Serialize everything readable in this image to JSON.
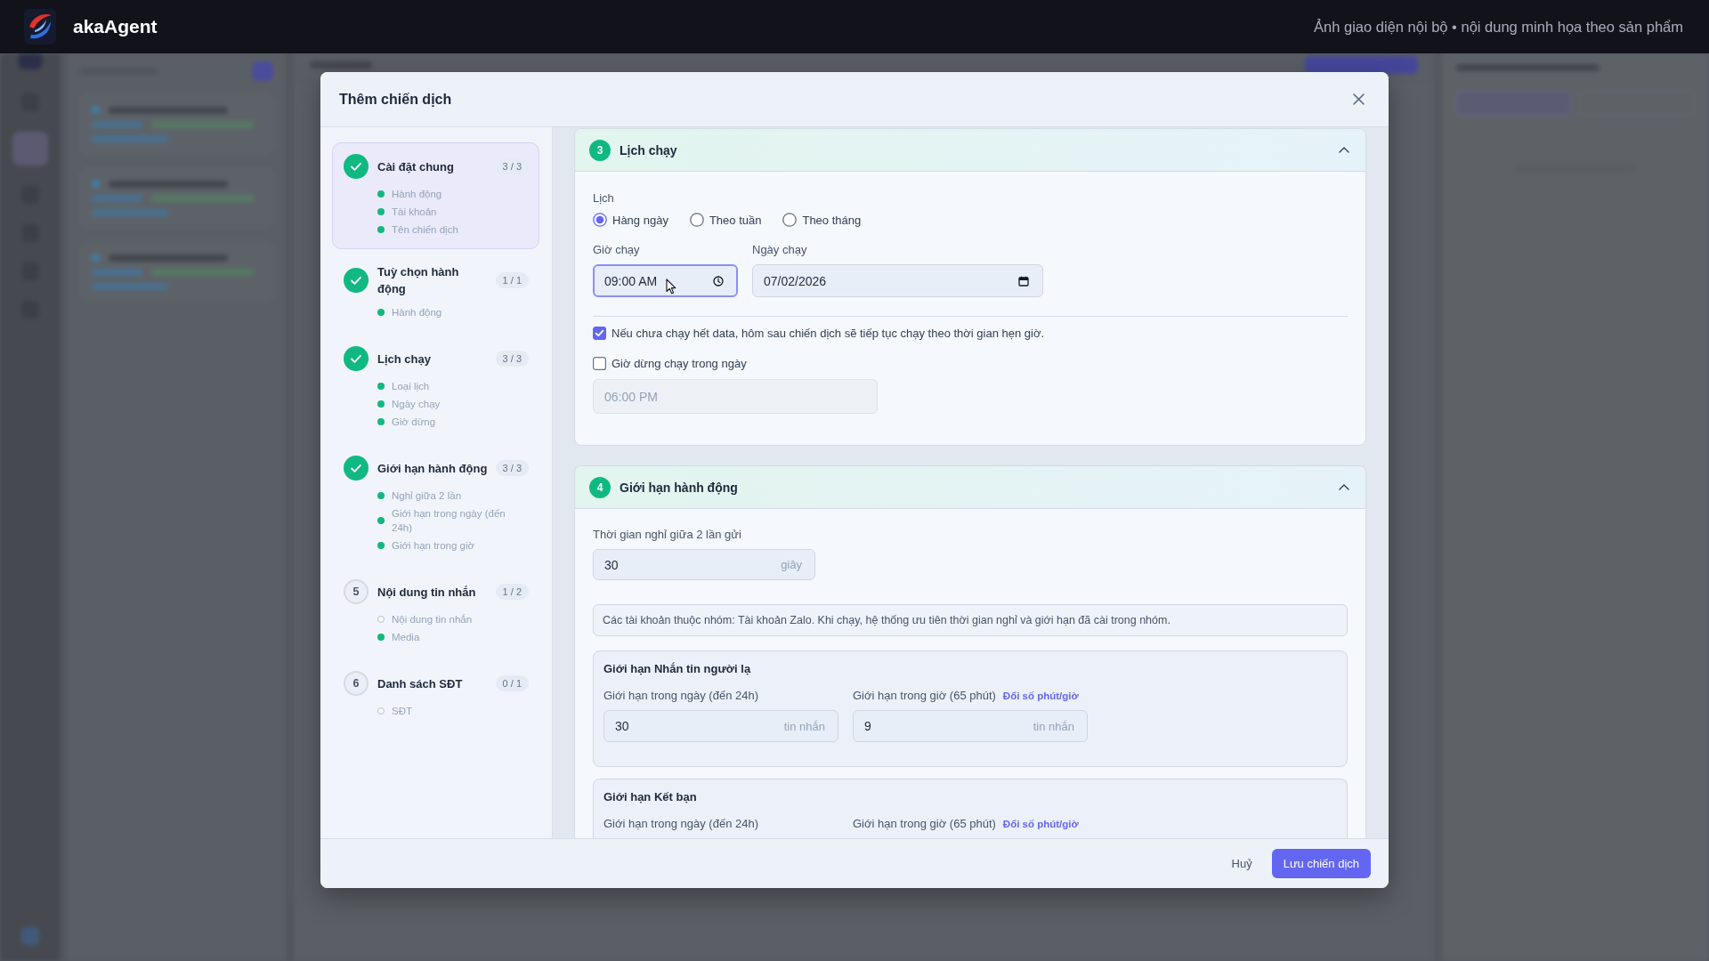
{
  "app_bar": {
    "brand": "akaAgent",
    "notice": "Ảnh giao diện nội bộ • nội dung minh họa theo sản phẩm"
  },
  "dialog": {
    "title": "Thêm chiến dịch",
    "steps": [
      {
        "title": "Cài đặt chung",
        "progress": "3 / 3",
        "done": true,
        "selected": true,
        "items": [
          {
            "label": "Hành động",
            "done": true
          },
          {
            "label": "Tài khoản",
            "done": true
          },
          {
            "label": "Tên chiến dịch",
            "done": true
          }
        ]
      },
      {
        "title": "Tuỳ chọn hành động",
        "progress": "1 / 1",
        "done": true,
        "selected": false,
        "items": [
          {
            "label": "Hành động",
            "done": true
          }
        ]
      },
      {
        "title": "Lịch chạy",
        "progress": "3 / 3",
        "done": true,
        "selected": false,
        "items": [
          {
            "label": "Loại lịch",
            "done": true
          },
          {
            "label": "Ngày chạy",
            "done": true
          },
          {
            "label": "Giờ dừng",
            "done": true
          }
        ]
      },
      {
        "title": "Giới hạn hành động",
        "progress": "3 / 3",
        "done": true,
        "selected": false,
        "items": [
          {
            "label": "Nghỉ giữa 2 lần",
            "done": true
          },
          {
            "label": "Giới hạn trong ngày (đến 24h)",
            "done": true
          },
          {
            "label": "Giới hạn trong giờ",
            "done": true
          }
        ]
      },
      {
        "number": "5",
        "title": "Nội dung tin nhắn",
        "progress": "1 / 2",
        "done": false,
        "selected": false,
        "items": [
          {
            "label": "Nội dung tin nhắn",
            "done": false
          },
          {
            "label": "Media",
            "done": true
          }
        ]
      },
      {
        "number": "6",
        "title": "Danh sách SĐT",
        "progress": "0 / 1",
        "done": false,
        "selected": false,
        "items": [
          {
            "label": "SĐT",
            "done": false
          }
        ]
      }
    ],
    "schedule_section": {
      "number": "3",
      "title": "Lịch chạy",
      "expanded": true,
      "schedule_label": "Lịch",
      "schedule_options": [
        {
          "label": "Hàng ngày",
          "selected": true
        },
        {
          "label": "Theo tuần",
          "selected": false
        },
        {
          "label": "Theo tháng",
          "selected": false
        }
      ],
      "time_field": {
        "label": "Giờ chạy",
        "value": "09:00 AM",
        "focused": true
      },
      "date_field": {
        "label": "Ngày chạy",
        "value": "07/02/2026"
      },
      "continue_option": {
        "label": "Nếu chưa chạy hết data, hôm sau chiến dịch sẽ tiếp tục chạy theo thời gian hẹn giờ.",
        "checked": true
      },
      "stop_option": {
        "label": "Giờ dừng chạy trong ngày",
        "checked": false
      },
      "stop_time_field": {
        "value": "06:00 PM",
        "disabled": true
      }
    },
    "limits_section": {
      "number": "4",
      "title": "Giới hạn hành động",
      "expanded": true,
      "rest_field": {
        "label": "Thời gian nghỉ giữa 2 lần gửi",
        "value": "30",
        "unit": "giây"
      },
      "info": "Các tài khoản thuộc nhóm: Tài khoản Zalo. Khi chạy, hệ thống ưu tiên thời gian nghỉ và giới hạn đã cài trong nhóm.",
      "groups": [
        {
          "title": "Giới hạn Nhắn tin người lạ",
          "daily": {
            "label": "Giới hạn trong ngày (đến 24h)",
            "value": "30",
            "unit": "tin nhắn"
          },
          "hourly": {
            "label": "Giới hạn trong giờ (65 phút)",
            "link": "Đổi số phút/giờ",
            "value": "9",
            "unit": "tin nhắn"
          }
        },
        {
          "title": "Giới hạn Kết bạn",
          "daily": {
            "label": "Giới hạn trong ngày (đến 24h)"
          },
          "hourly": {
            "label": "Giới hạn trong giờ (65 phút)",
            "link": "Đổi số phút/giờ"
          }
        }
      ]
    },
    "footer": {
      "cancel": "Huỷ",
      "save": "Lưu chiến dịch"
    }
  }
}
